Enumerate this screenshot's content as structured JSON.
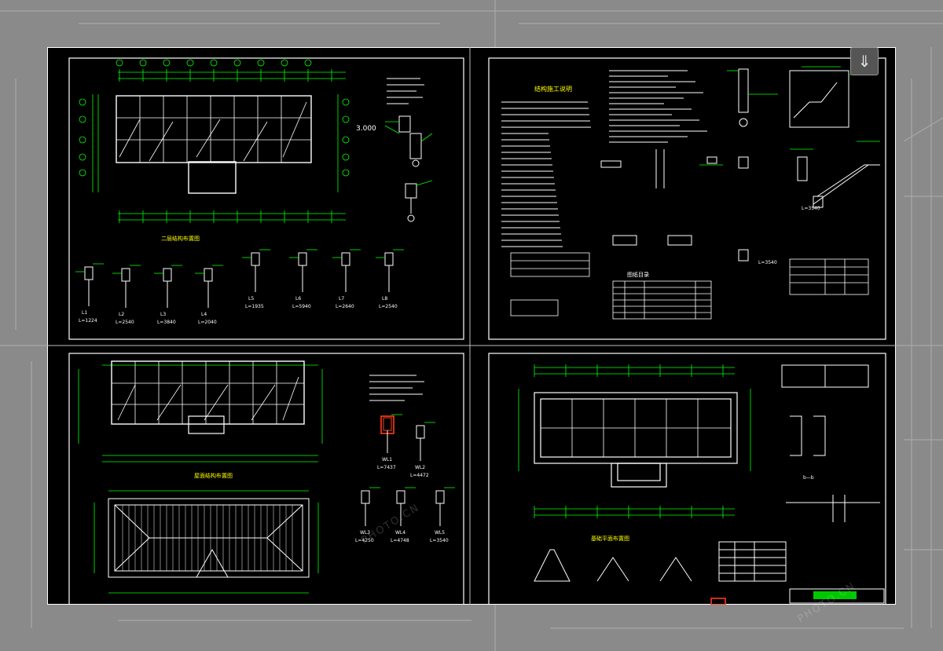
{
  "drawing_sheet": {
    "colors": {
      "background": "#000000",
      "frame": "#ffffff",
      "dimension": "#00ff00",
      "structure": "#ffffff",
      "note": "#ffff00",
      "axis_bubble": "#00ff00",
      "highlight": "#ff3b1a",
      "backdrop": "#8a8a8a"
    },
    "panels": {
      "top_left": {
        "elevation_mark": "3.000",
        "beam_lengths": [
          "L=1224",
          "L=2540",
          "L=3840",
          "L=2040",
          "L=1935",
          "L=5940",
          "L=2640",
          "L=2540"
        ],
        "beam_names": [
          "L1",
          "L2",
          "L3",
          "L4",
          "L5",
          "L6",
          "L7",
          "L8"
        ]
      },
      "top_right": {
        "beam_lengths": [
          "L=3540",
          "L=3540"
        ]
      },
      "bottom_left": {
        "beam_lengths": [
          "L=7437",
          "L=4472",
          "L=4250",
          "L=4748",
          "L=3540"
        ],
        "beam_names": [
          "WL1",
          "WL2",
          "WL3",
          "WL4",
          "WL5"
        ]
      },
      "bottom_right": {
        "section_label": "b—b"
      }
    },
    "watermark": "PHOTO.CN",
    "collapse_icon": "double-chevron-down-icon"
  }
}
